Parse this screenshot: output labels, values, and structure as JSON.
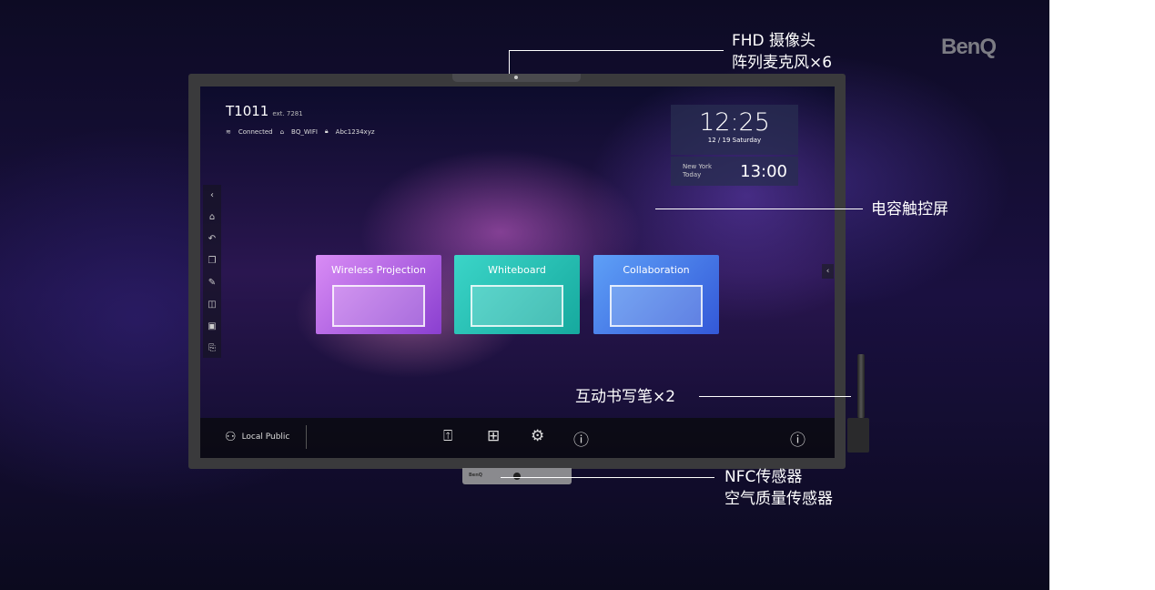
{
  "brand": "BenQ",
  "callouts": {
    "camera": [
      "FHD 摄像头",
      "阵列麦克风×6"
    ],
    "touchscreen": "电容触控屏",
    "pen": "互动书写笔×2",
    "sensors": [
      "NFC传感器",
      "空气质量传感器"
    ]
  },
  "screen": {
    "device_name": "T1011",
    "extension": "ext. 7281",
    "network": {
      "status": "Connected",
      "ssid": "BQ_WIFI",
      "password": "Abc1234xyz"
    },
    "clock": {
      "time": "12:25",
      "date": "12 / 19 Saturday"
    },
    "world_clock": {
      "city": "New York",
      "day": "Today",
      "time": "13:00"
    },
    "sidebar_icons": [
      "chevron-left-icon",
      "home-icon",
      "back-icon",
      "windows-icon",
      "pen-icon",
      "split-icon",
      "pip-icon",
      "input-icon"
    ],
    "apps": [
      {
        "label": "Wireless Projection",
        "color": "#a855e0"
      },
      {
        "label": "Whiteboard",
        "color": "#22bdb2"
      },
      {
        "label": "Collaboration",
        "color": "#4a7ce8"
      }
    ],
    "taskbar": {
      "user": "Local Public"
    }
  }
}
